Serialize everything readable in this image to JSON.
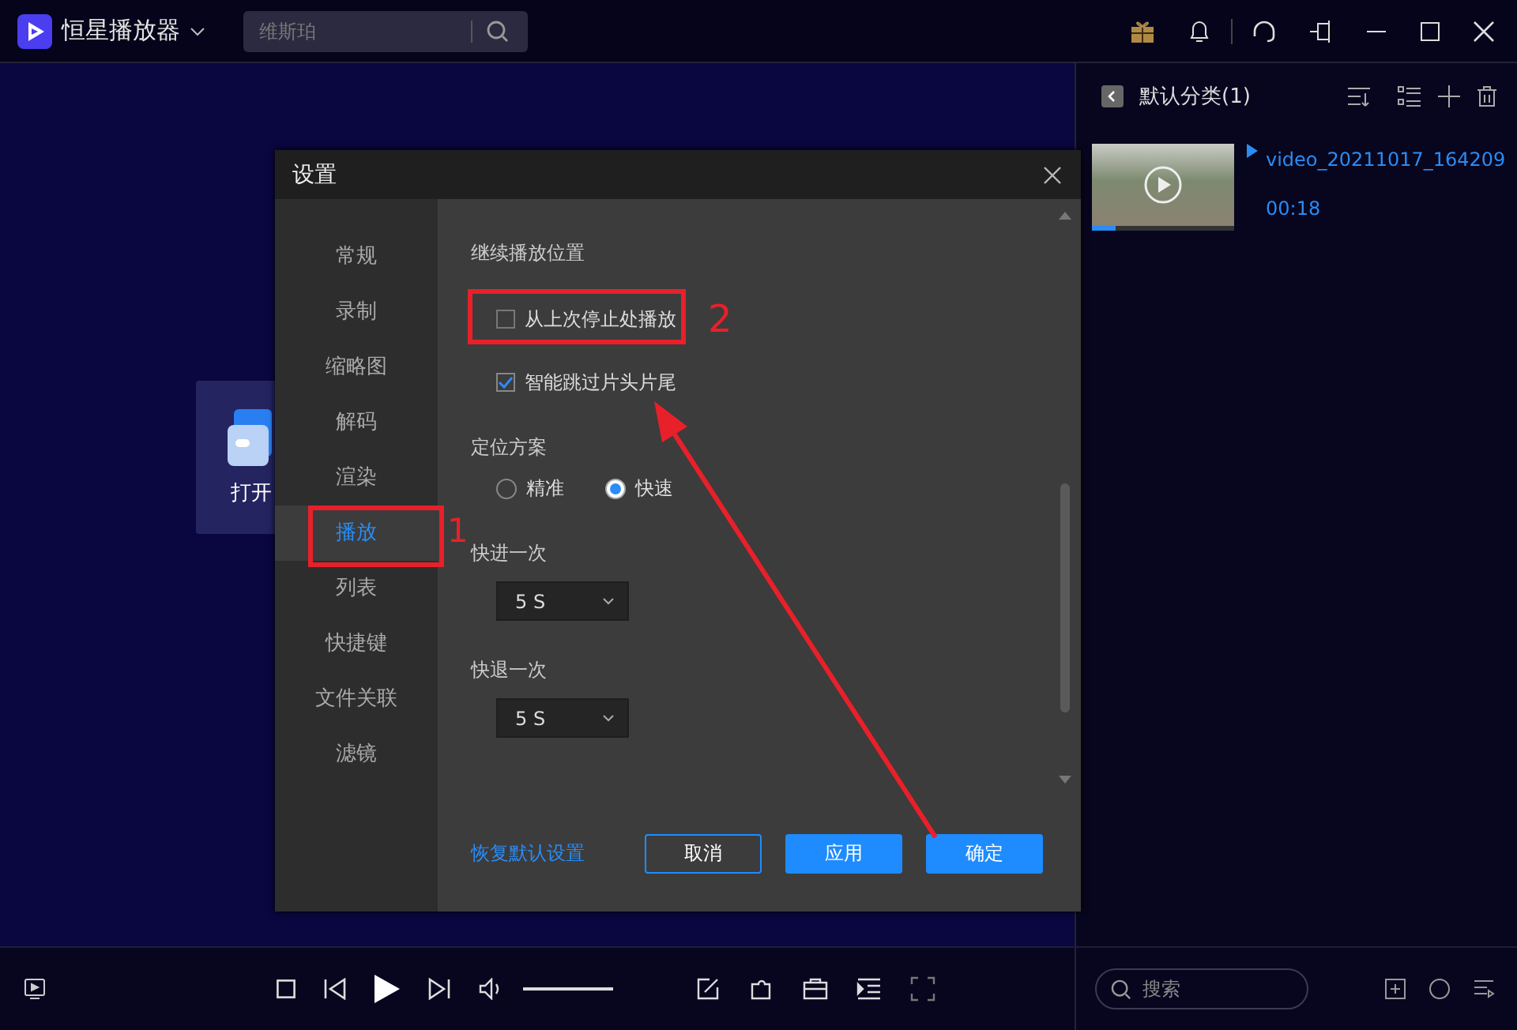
{
  "app": {
    "title": "恒星播放器",
    "search": {
      "placeholder": "维斯珀"
    }
  },
  "open_card": {
    "label": "打开"
  },
  "playlist": {
    "title": "默认分类(1)",
    "items": [
      {
        "name": "video_20211017_164209",
        "duration": "00:18",
        "playing": true,
        "level": 0.17
      }
    ]
  },
  "dialog": {
    "title": "设置",
    "nav": [
      {
        "label": "常规",
        "selected": false
      },
      {
        "label": "录制",
        "selected": false
      },
      {
        "label": "缩略图",
        "selected": false
      },
      {
        "label": "解码",
        "selected": false
      },
      {
        "label": "渲染",
        "selected": false
      },
      {
        "label": "播放",
        "selected": true
      },
      {
        "label": "列表",
        "selected": false
      },
      {
        "label": "快捷键",
        "selected": false
      },
      {
        "label": "文件关联",
        "selected": false
      },
      {
        "label": "滤镜",
        "selected": false
      }
    ],
    "sections": [
      {
        "heading": "继续播放位置",
        "controls": [
          {
            "kind": "checkbox",
            "label": "从上次停止处播放",
            "checked": false
          },
          {
            "kind": "checkbox",
            "label": "智能跳过片头片尾",
            "checked": true
          }
        ]
      },
      {
        "heading": "定位方案",
        "controls": [
          {
            "kind": "radio",
            "options": [
              {
                "label": "精准",
                "selected": false
              },
              {
                "label": "快速",
                "selected": true
              }
            ]
          }
        ]
      },
      {
        "heading": "快进一次",
        "controls": [
          {
            "kind": "select",
            "value": "5 S"
          }
        ]
      },
      {
        "heading": "快退一次",
        "controls": [
          {
            "kind": "select",
            "value": "5 S"
          }
        ]
      }
    ],
    "reset_link": "恢复默认设置",
    "buttons": [
      {
        "label": "取消",
        "kind": "outline"
      },
      {
        "label": "应用",
        "kind": "primary"
      },
      {
        "label": "确定",
        "kind": "primary"
      }
    ]
  },
  "player": {
    "volume": {
      "level": 1
    },
    "search": {
      "placeholder": "搜索"
    }
  },
  "annotations": [
    {
      "label": "1"
    },
    {
      "label": "2"
    }
  ]
}
